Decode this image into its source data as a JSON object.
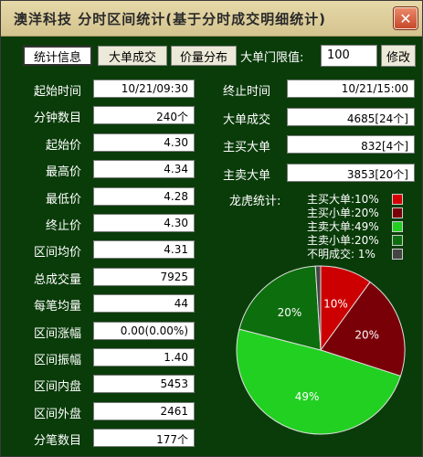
{
  "window": {
    "title": "澳洋科技  分时区间统计(基于分时成交明细统计)",
    "close_symbol": "✕"
  },
  "tabs": [
    {
      "label": "统计信息",
      "active": true
    },
    {
      "label": "大单成交",
      "active": false
    },
    {
      "label": "价量分布",
      "active": false
    }
  ],
  "threshold": {
    "label": "大单门限值:",
    "value": "100",
    "modify_label": "修改"
  },
  "left_stats": [
    {
      "label": "起始时间",
      "value": "10/21/09:30"
    },
    {
      "label": "分钟数目",
      "value": "240个"
    },
    {
      "label": "起始价",
      "value": "4.30"
    },
    {
      "label": "最高价",
      "value": "4.34"
    },
    {
      "label": "最低价",
      "value": "4.28"
    },
    {
      "label": "终止价",
      "value": "4.30"
    },
    {
      "label": "区间均价",
      "value": "4.31"
    },
    {
      "label": "总成交量",
      "value": "7925"
    },
    {
      "label": "每笔均量",
      "value": "44"
    },
    {
      "label": "区间涨幅",
      "value": "0.00(0.00%)"
    },
    {
      "label": "区间振幅",
      "value": "1.40"
    },
    {
      "label": "区间内盘",
      "value": "5453"
    },
    {
      "label": "区间外盘",
      "value": "2461"
    },
    {
      "label": "分笔数目",
      "value": "177个"
    }
  ],
  "right_stats": [
    {
      "label": "终止时间",
      "value": "10/21/15:00"
    },
    {
      "label": "大单成交",
      "value": "4685[24个]"
    },
    {
      "label": "主买大单",
      "value": "832[4个]"
    },
    {
      "label": "主卖大单",
      "value": "3853[20个]"
    }
  ],
  "legend": {
    "title": "龙虎统计:",
    "items": [
      {
        "label": "主买大单:10%",
        "color": "#d40000"
      },
      {
        "label": "主买小单:20%",
        "color": "#7a0008"
      },
      {
        "label": "主卖大单:49%",
        "color": "#22d022"
      },
      {
        "label": "主卖小单:20%",
        "color": "#0d6e0d"
      },
      {
        "label": "不明成交: 1%",
        "color": "#444444"
      }
    ]
  },
  "chart_data": {
    "type": "pie",
    "title": "龙虎统计",
    "slices": [
      {
        "name": "主买大单",
        "value": 10,
        "label": "10%",
        "color": "#cc0000"
      },
      {
        "name": "主买小单",
        "value": 20,
        "label": "20%",
        "color": "#7a0008"
      },
      {
        "name": "主卖大单",
        "value": 49,
        "label": "49%",
        "color": "#22d022"
      },
      {
        "name": "主卖小单",
        "value": 20,
        "label": "20%",
        "color": "#0d6e0d"
      },
      {
        "name": "不明成交",
        "value": 1,
        "label": "",
        "color": "#444444"
      }
    ]
  }
}
